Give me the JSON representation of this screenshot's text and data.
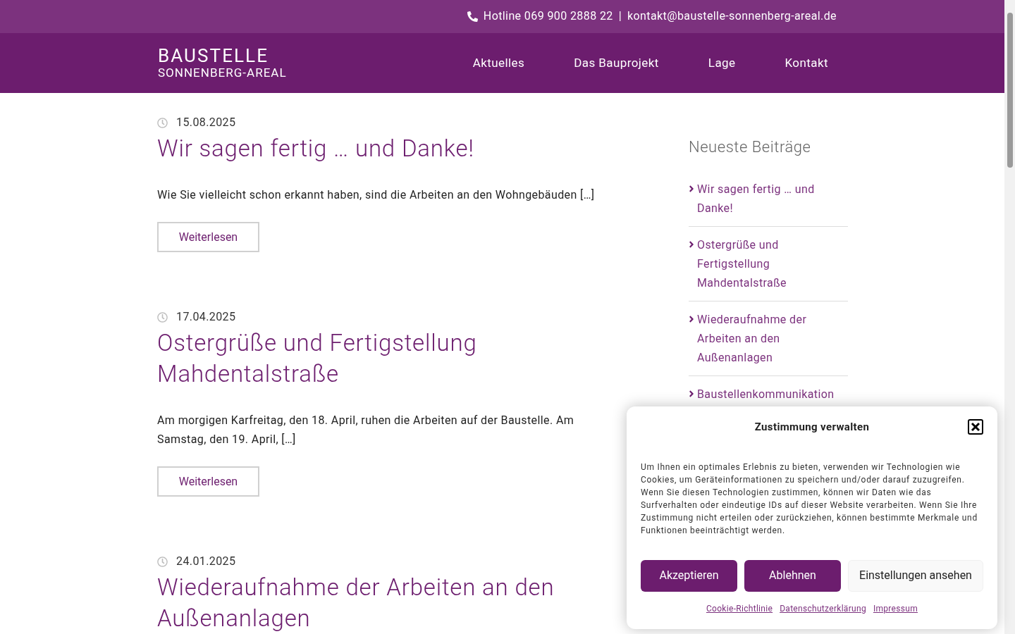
{
  "topbar": {
    "hotline": "Hotline 069 900 2888 22",
    "separator": "|",
    "email": "kontakt@baustelle-sonnenberg-areal.de"
  },
  "logo": {
    "line1": "BAUSTELLE",
    "line2": "SONNENBERG-AREAL"
  },
  "nav": [
    {
      "label": "Aktuelles",
      "selected": false
    },
    {
      "label": "Das Bauprojekt",
      "selected": false
    },
    {
      "label": "Lage",
      "selected": false
    },
    {
      "label": "Kontakt",
      "selected": false
    }
  ],
  "posts": [
    {
      "date": "15.08.2025",
      "title": "Wir sagen fertig … und Danke!",
      "excerpt": "Wie Sie vielleicht schon erkannt haben, sind die Arbeiten an den Wohngebäuden […]",
      "button": "Weiterlesen"
    },
    {
      "date": "17.04.2025",
      "title": "Ostergrüße und Fertigstellung Mahdentalstraße",
      "excerpt": "Am morgigen Karfreitag, den 18. April, ruhen die Arbeiten auf der Baustelle. Am Samstag, den 19. April, […]",
      "button": "Weiterlesen"
    },
    {
      "date": "24.01.2025",
      "title": "Wiederaufnahme der Arbeiten an den Außenanlagen"
    }
  ],
  "sidebar": {
    "title": "Neueste Beiträge",
    "items": [
      "Wir sagen fertig … und Danke!",
      "Ostergrüße und Fertigstellung Mahdentalstraße",
      "Wiederaufnahme der Arbeiten an den Außenanlagen",
      "Baustellenkommunikation"
    ]
  },
  "consent": {
    "title": "Zustimmung verwalten",
    "text": "Um Ihnen ein optimales Erlebnis zu bieten, verwenden wir Technologien wie Cookies, um Geräteinformationen zu speichern und/oder darauf zuzugreifen. Wenn Sie diesen Technologien zustimmen, können wir Daten wie das Surfverhalten oder eindeutige IDs auf dieser Website verarbeiten. Wenn Sie Ihre Zustimmung nicht erteilen oder zurückziehen, können bestimmte Merkmale und Funktionen beeinträchtigt werden.",
    "buttons": [
      {
        "label": "Akzeptieren",
        "kind": "primary"
      },
      {
        "label": "Ablehnen",
        "kind": "primary"
      },
      {
        "label": "Einstellungen ansehen",
        "kind": "secondary"
      }
    ],
    "links": [
      "Cookie-Richtlinie",
      "Datenschutzerklärung",
      "Impressum"
    ]
  }
}
